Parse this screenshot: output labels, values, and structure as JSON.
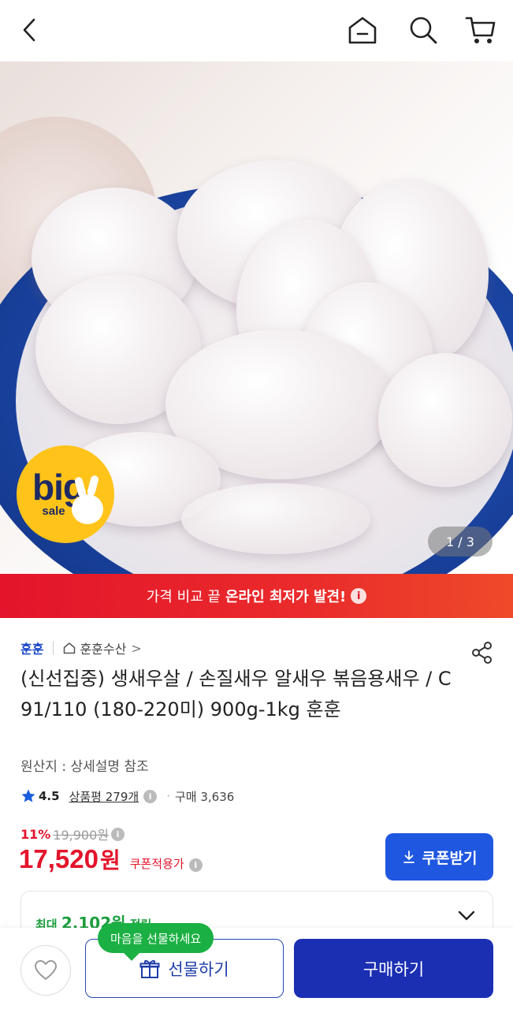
{
  "header": {
    "icons": [
      "back-arrow-icon",
      "home-icon",
      "search-icon",
      "cart-icon"
    ]
  },
  "hero": {
    "badge_big": "big",
    "badge_sale": "sale",
    "pager": "1 / 3"
  },
  "promo": {
    "text": "가격 비교 끝",
    "strong": "온라인 최저가 발견!",
    "info_icon": "i"
  },
  "product": {
    "brand": "훈훈",
    "store": "훈훈수산",
    "store_chevron": ">",
    "title": "(신선집중) 생새우살 / 손질새우 알새우 볶음용새우 / C 91/110 (180-220미) 900g-1kg 훈훈",
    "origin": "원산지 : 상세설명 참조",
    "rating": "4.5",
    "reviews": "상품평 279개",
    "purchases": "구매 3,636",
    "discount": "11%",
    "original_price": "19,900원",
    "price": "17,520",
    "price_unit": "원",
    "coupon_applied": "쿠폰적용가",
    "coupon_button": "쿠폰받기",
    "points_prefix": "최대",
    "points_value": "2,102원",
    "points_suffix": "적립"
  },
  "bottom": {
    "tooltip": "마음을 선물하세요",
    "gift_button": "선물하기",
    "buy_button": "구매하기"
  },
  "colors": {
    "accent_red": "#e3142b",
    "brand_blue": "#1a47c7",
    "buy_blue": "#1b2fb3",
    "coupon_blue": "#1f57e0",
    "tooltip_green": "#1bb043",
    "badge_yellow": "#ffc31a"
  }
}
